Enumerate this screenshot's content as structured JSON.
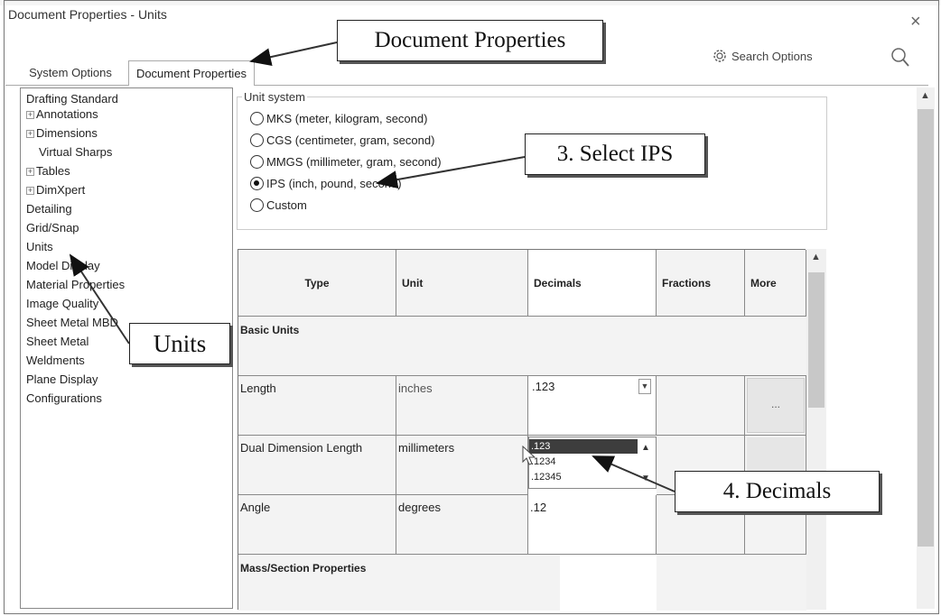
{
  "window": {
    "title": "Document Properties - Units",
    "close_glyph": "×"
  },
  "search": {
    "label": "Search Options"
  },
  "tabs": [
    {
      "label": "System Options"
    },
    {
      "label": "Document Properties"
    }
  ],
  "tree": {
    "items": [
      {
        "label": "Drafting Standard",
        "expandable": false
      },
      {
        "label": "Annotations",
        "expandable": true
      },
      {
        "label": "Dimensions",
        "expandable": true
      },
      {
        "label": "Virtual Sharps",
        "expandable": false
      },
      {
        "label": "Tables",
        "expandable": true
      },
      {
        "label": "DimXpert",
        "expandable": true
      },
      {
        "label": "Detailing",
        "expandable": false
      },
      {
        "label": "Grid/Snap",
        "expandable": false
      },
      {
        "label": "Units",
        "expandable": false
      },
      {
        "label": "Model Display",
        "expandable": false
      },
      {
        "label": "Material Properties",
        "expandable": false
      },
      {
        "label": "Image Quality",
        "expandable": false
      },
      {
        "label": "Sheet Metal MBD",
        "expandable": false
      },
      {
        "label": "Sheet Metal",
        "expandable": false
      },
      {
        "label": "Weldments",
        "expandable": false
      },
      {
        "label": "Plane Display",
        "expandable": false
      },
      {
        "label": "Configurations",
        "expandable": false
      }
    ]
  },
  "unit_system": {
    "label": "Unit system",
    "options": [
      {
        "label": "MKS  (meter, kilogram, second)",
        "selected": false
      },
      {
        "label": "CGS  (centimeter, gram, second)",
        "selected": false
      },
      {
        "label": "MMGS (millimeter, gram, second)",
        "selected": false
      },
      {
        "label": "IPS  (inch, pound, second)",
        "selected": true
      },
      {
        "label": "Custom",
        "selected": false
      }
    ]
  },
  "table": {
    "headers": {
      "type": "Type",
      "unit": "Unit",
      "decimals": "Decimals",
      "fractions": "Fractions",
      "more": "More"
    },
    "sections": {
      "basic": "Basic Units",
      "mass": "Mass/Section Properties"
    },
    "rows": [
      {
        "type": "Length",
        "unit": "inches",
        "decimals": ".123",
        "more": "..."
      },
      {
        "type": "Dual Dimension Length",
        "unit": "millimeters",
        "decimals": ".123"
      },
      {
        "type": "Angle",
        "unit": "degrees",
        "decimals": ".12"
      }
    ],
    "decimal_options": [
      ".123",
      ".1234",
      ".12345"
    ]
  },
  "callouts": {
    "doc_props": "Document Properties",
    "select_ips": "3. Select IPS",
    "units": "Units",
    "decimals": "4. Decimals"
  }
}
